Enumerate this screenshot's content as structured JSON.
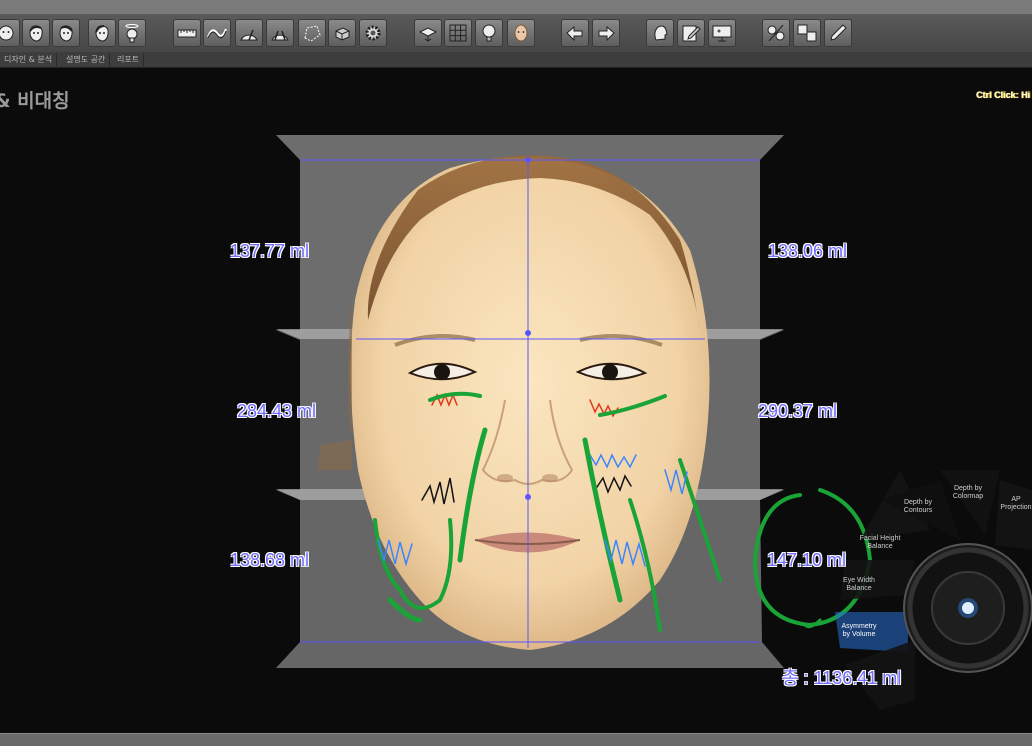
{
  "window": {
    "title": ""
  },
  "tabs": [
    {
      "label": "디자인 & 분석"
    },
    {
      "label": "설명도 공간"
    },
    {
      "label": "리포트"
    }
  ],
  "page_title": "& 비대칭",
  "hint_text": "Ctrl Click: Hi",
  "volumes": {
    "upper_left": "137.77 ml",
    "upper_right": "138.06 ml",
    "middle_left": "284.43 ml",
    "middle_right": "290.37 ml",
    "lower_left": "138.68 ml",
    "lower_right": "147.10 ml",
    "total": "총 : 1136.41 ml"
  },
  "dial_menu": {
    "items": [
      {
        "label": "Depth by\nContours"
      },
      {
        "label": "Depth by\nColormap"
      },
      {
        "label": "AP\nProjection"
      },
      {
        "label": "Facial Height\nBalance"
      },
      {
        "label": "Eye Width\nBalance"
      },
      {
        "label": "Asymmetry\nby Volume"
      }
    ],
    "active": "Asymmetry by Volume"
  },
  "toolbar": {
    "buttons": [
      "face-front-icon",
      "face-left-icon",
      "face-right-icon",
      "face-three-quarter-icon",
      "head-rotate-icon",
      "ruler-icon",
      "curve-icon",
      "angle-measure-icon",
      "angle-measure-2-icon",
      "polygon-select-icon",
      "cube-icon",
      "gear-icon",
      "layers-icon",
      "grid-icon",
      "light-bulb-icon",
      "face-texture-icon",
      "undo-icon",
      "redo-icon",
      "head-side-icon",
      "edit-note-icon",
      "presentation-icon",
      "before-after-icon",
      "compare-icon",
      "pen-icon"
    ]
  },
  "colors": {
    "measure_text": "#6f6cff",
    "annotation_green": "#1aa336",
    "annotation_blue": "#3a86ff",
    "annotation_red": "#e03a1a"
  }
}
